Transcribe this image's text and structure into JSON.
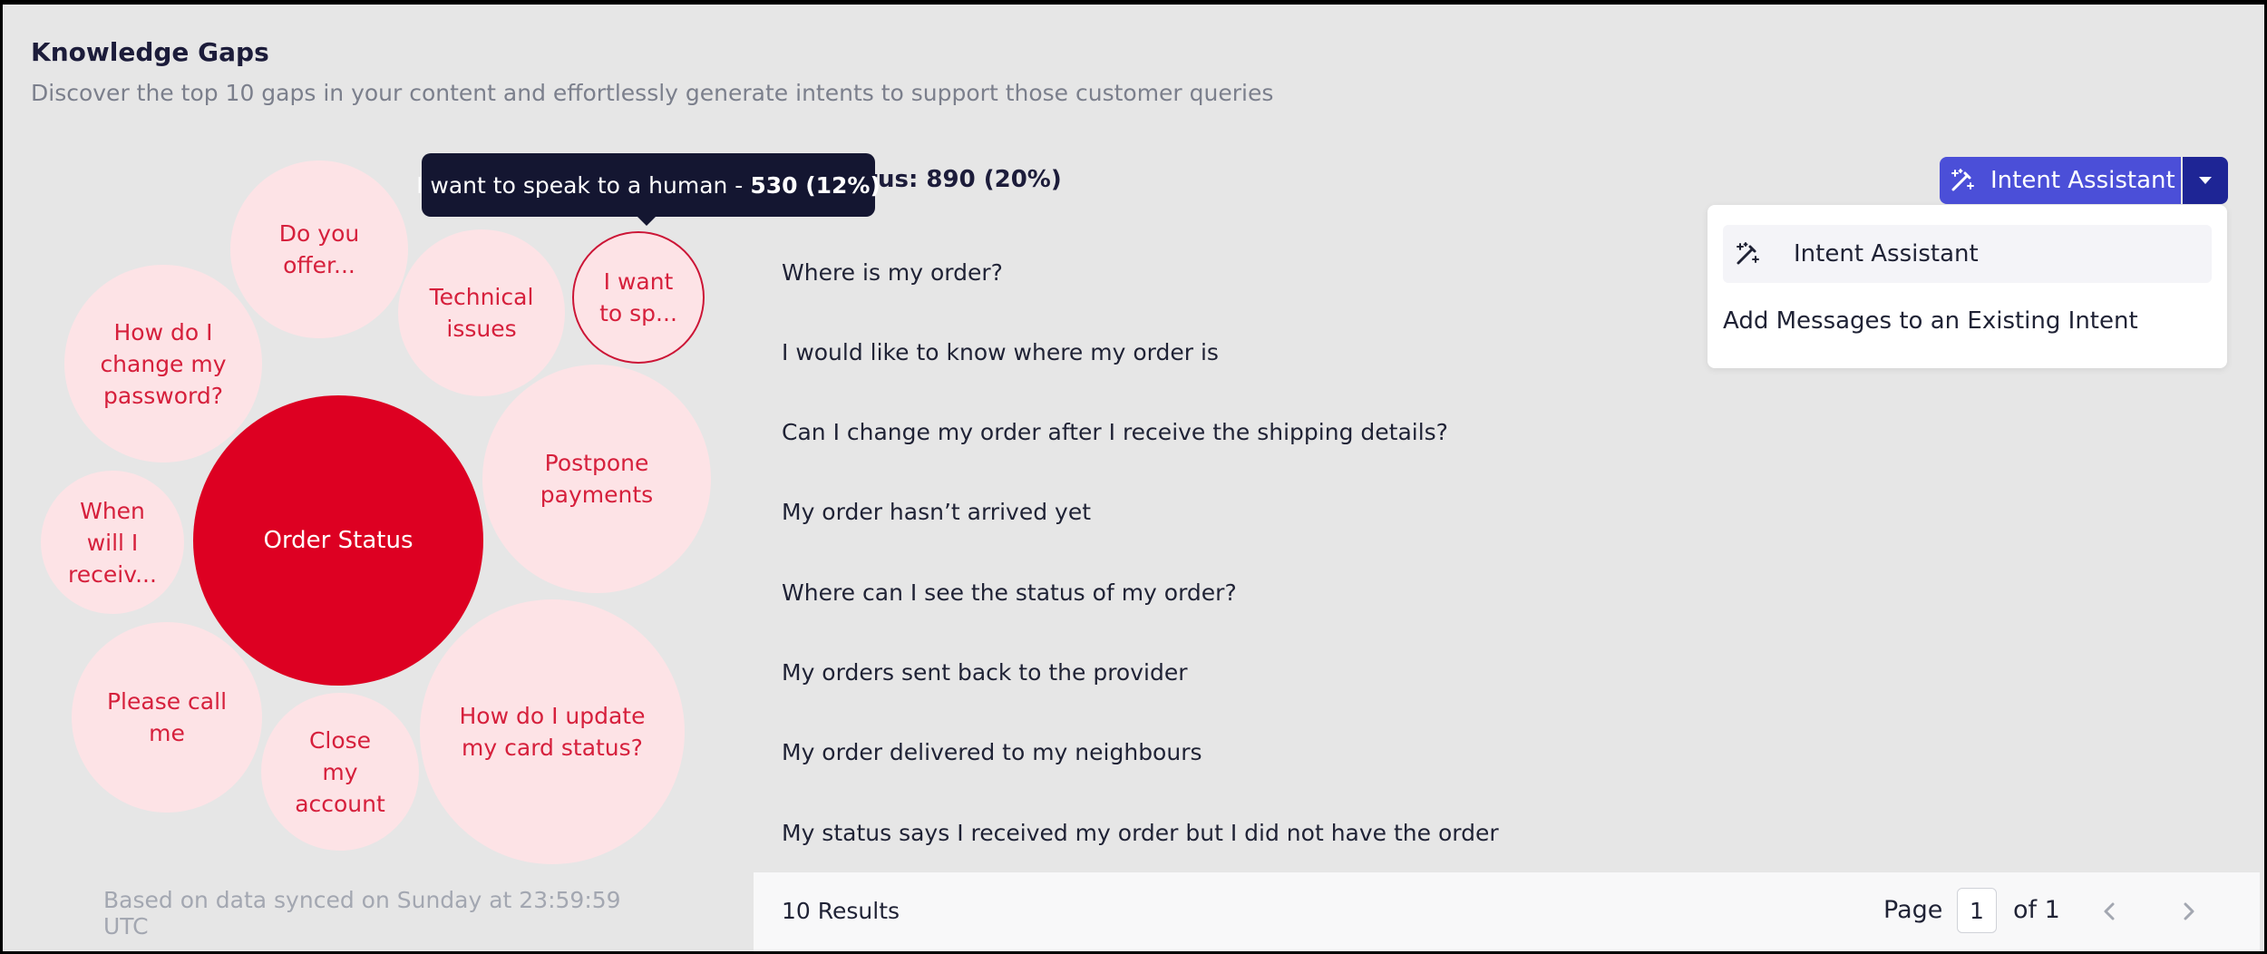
{
  "header": {
    "title": "Knowledge Gaps",
    "subtitle": "Discover the top 10 gaps in your content and effortlessly generate intents to support those customer queries"
  },
  "bubbles": [
    {
      "label": "Do you offer..."
    },
    {
      "label": "How do I change my password?"
    },
    {
      "label": "Technical issues"
    },
    {
      "label": "I want to sp..."
    },
    {
      "label": "Postpone payments"
    },
    {
      "label": "When will I receiv..."
    },
    {
      "label": "Order Status"
    },
    {
      "label": "Please call me"
    },
    {
      "label": "Close my account"
    },
    {
      "label": "How do I update my card status?"
    }
  ],
  "tooltip": {
    "label": "I want to speak to a human -",
    "count": "530 (12%)"
  },
  "synced_note": "Based on data synced on Sunday at 23:59:59 UTC",
  "detail": {
    "heading_visible": "atus: 890 (20%)",
    "messages": [
      "Where is my order?",
      "I would like to know where my order is",
      "Can I change my order after I receive the shipping details?",
      "My order hasn’t arrived yet",
      "Where can I see the status of my order?",
      "My orders sent back to the provider",
      "My order delivered to my neighbours",
      "My status says I received my order but I did not have the order"
    ]
  },
  "footer": {
    "results": "10 Results",
    "page_label": "Page",
    "page_value": "1",
    "page_of": "of 1"
  },
  "intent_button": {
    "label": "Intent Assistant"
  },
  "dropdown": {
    "items": [
      {
        "label": "Intent Assistant",
        "icon": "magic-wand-icon"
      },
      {
        "label": "Add Messages to an Existing Intent"
      }
    ]
  },
  "colors": {
    "bubble_light": "#fde3e6",
    "bubble_main": "#dd0022",
    "bubble_text": "#d6203c",
    "button_primary": "#4b4fd8",
    "button_caret": "#1e2595",
    "tooltip_bg": "#141631"
  }
}
